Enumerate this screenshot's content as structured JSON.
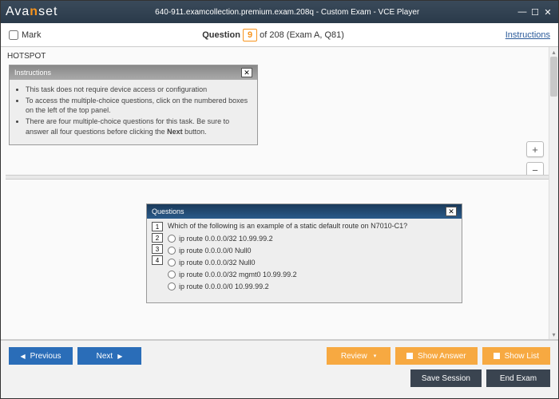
{
  "titlebar": {
    "brand_a": "Ava",
    "brand_b": "n",
    "brand_c": "set",
    "title": "640-911.examcollection.premium.exam.208q - Custom Exam - VCE Player"
  },
  "info": {
    "mark": "Mark",
    "q_label": "Question",
    "q_num": "9",
    "q_rest": " of 208 (Exam A, Q81)",
    "instructions": "Instructions"
  },
  "hotspot": "HOTSPOT",
  "inst_panel": {
    "header": "Instructions",
    "items": [
      "This task does not require device access or configuration",
      "To access the multiple-choice questions, click on the numbered boxes on the left of the top panel.",
      "There are four multiple-choice questions for this task. Be sure to answer all four questions before clicking the Next button."
    ]
  },
  "questions_panel": {
    "header": "Questions",
    "nums": [
      "1",
      "2",
      "3",
      "4"
    ],
    "prompt": "Which of the following is an example of a static default route on N7010-C1?",
    "options": [
      "ip route 0.0.0.0/32 10.99.99.2",
      "ip route 0.0.0.0/0 Null0",
      "ip route 0.0.0.0/32 Null0",
      "ip route 0.0.0.0/32 mgmt0 10.99.99.2",
      "ip route 0.0.0.0/0 10.99.99.2"
    ]
  },
  "footer": {
    "previous": "Previous",
    "next": "Next",
    "review": "Review",
    "show_answer": "Show Answer",
    "show_list": "Show List",
    "save_session": "Save Session",
    "end_exam": "End Exam"
  }
}
